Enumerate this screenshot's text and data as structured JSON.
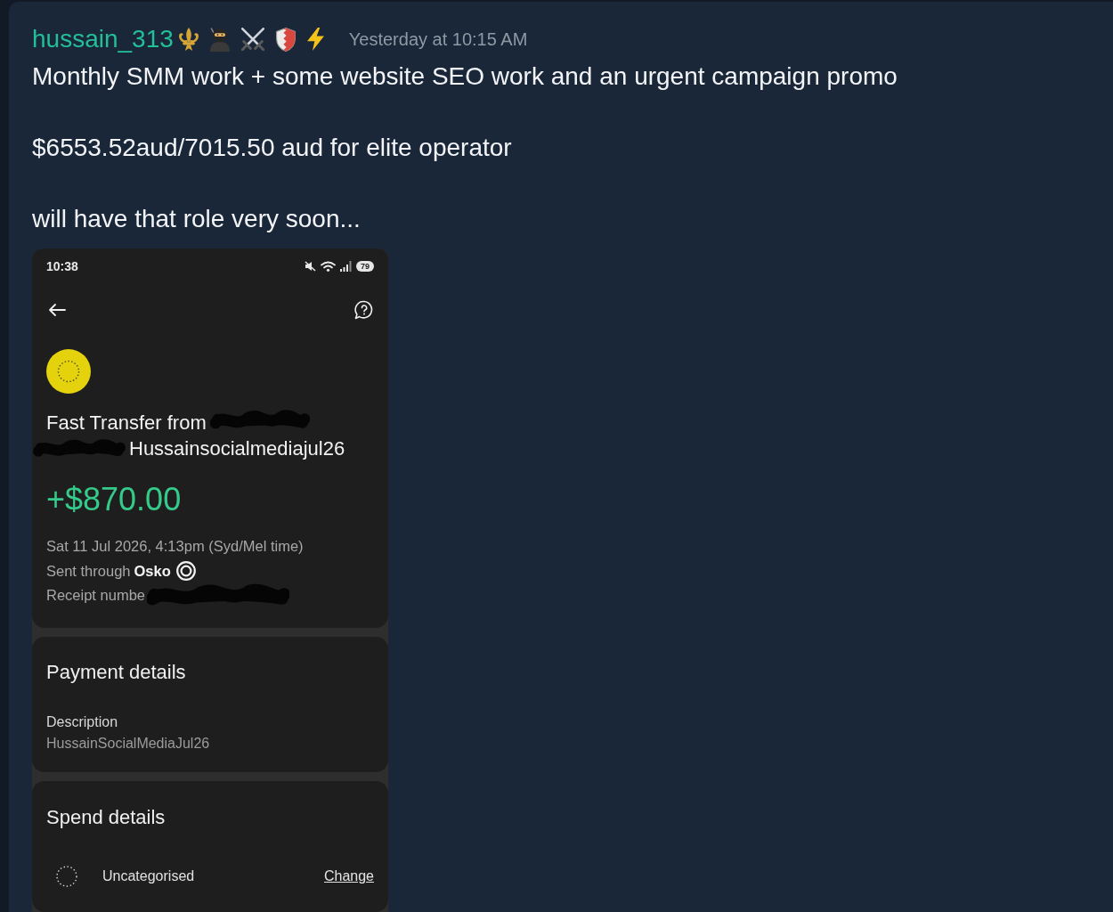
{
  "message": {
    "author": "hussain_313",
    "timestamp": "Yesterday at 10:15 AM",
    "paragraphs": [
      "Monthly SMM work + some website SEO work and an urgent campaign promo",
      "$6553.52aud/7015.50 aud for elite operator",
      "will have that role very soon..."
    ]
  },
  "attachment": {
    "status_bar": {
      "time": "10:38",
      "battery": "79"
    },
    "transaction": {
      "title": "Fast Transfer from",
      "reference": "Hussainsocialmediajul26",
      "amount": "+$870.00",
      "date": "Sat 11 Jul 2026, 4:13pm (Syd/Mel time)",
      "sent_through_label": "Sent through",
      "network": "Osko",
      "receipt_label": "Receipt numbe"
    },
    "payment_details": {
      "title": "Payment details",
      "fields": [
        {
          "label": "Description",
          "value": "HussainSocialMediaJul26"
        }
      ]
    },
    "spend_details": {
      "title": "Spend details",
      "category": "Uncategorised",
      "action": "Change"
    }
  }
}
